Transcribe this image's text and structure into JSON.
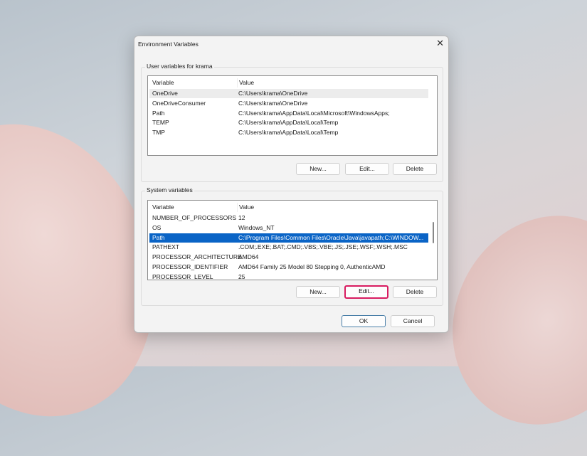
{
  "dialog": {
    "title": "Environment Variables",
    "close_icon": "close-icon"
  },
  "user_vars": {
    "label": "User variables for krama",
    "columns": [
      "Variable",
      "Value"
    ],
    "rows": [
      [
        "OneDrive",
        "C:\\Users\\krama\\OneDrive"
      ],
      [
        "OneDriveConsumer",
        "C:\\Users\\krama\\OneDrive"
      ],
      [
        "Path",
        "C:\\Users\\krama\\AppData\\Local\\Microsoft\\WindowsApps;"
      ],
      [
        "TEMP",
        "C:\\Users\\krama\\AppData\\Local\\Temp"
      ],
      [
        "TMP",
        "C:\\Users\\krama\\AppData\\Local\\Temp"
      ]
    ],
    "buttons": {
      "new": "New...",
      "edit": "Edit...",
      "delete": "Delete"
    }
  },
  "system_vars": {
    "label": "System variables",
    "columns": [
      "Variable",
      "Value"
    ],
    "rows": [
      [
        "NUMBER_OF_PROCESSORS",
        "12"
      ],
      [
        "OS",
        "Windows_NT"
      ],
      [
        "Path",
        "C:\\Program Files\\Common Files\\Oracle\\Java\\javapath;C:\\WINDOW..."
      ],
      [
        "PATHEXT",
        ".COM;.EXE;.BAT;.CMD;.VBS;.VBE;.JS;.JSE;.WSF;.WSH;.MSC"
      ],
      [
        "PROCESSOR_ARCHITECTURE",
        "AMD64"
      ],
      [
        "PROCESSOR_IDENTIFIER",
        "AMD64 Family 25 Model 80 Stepping 0, AuthenticAMD"
      ],
      [
        "PROCESSOR_LEVEL",
        "25"
      ]
    ],
    "selected_index": 2,
    "buttons": {
      "new": "New...",
      "edit": "Edit...",
      "delete": "Delete"
    }
  },
  "footer": {
    "ok": "OK",
    "cancel": "Cancel"
  },
  "colors": {
    "selection": "#0a64c6",
    "highlight_border": "#d81b60"
  }
}
